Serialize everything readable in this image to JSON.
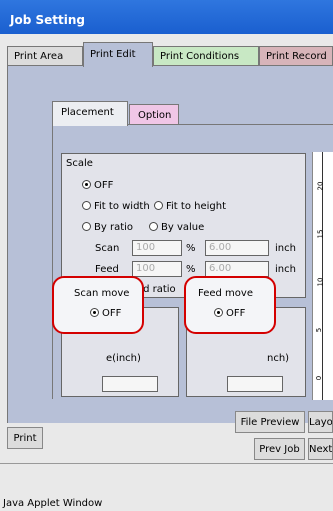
{
  "window": {
    "title": "Job Setting",
    "footer": "Java Applet Window"
  },
  "tabs": [
    "Print Area",
    "Print Edit",
    "Print Conditions",
    "Print Record"
  ],
  "inner_tabs": [
    "Placement",
    "Option"
  ],
  "scale": {
    "title": "Scale",
    "opt_off": "OFF",
    "opt_fit_width": "Fit to width",
    "opt_fit_height": "Fit to height",
    "opt_by_ratio": "By ratio",
    "opt_by_value": "By value",
    "scan_label": "Scan",
    "feed_label": "Feed",
    "scan_ratio": "100",
    "feed_ratio": "100",
    "percent": "%",
    "scan_value": "6.00",
    "feed_value": "6.00",
    "unit": "inch",
    "fixed_ratio": "Enter fixed ratio"
  },
  "scan_move": {
    "title": "Scan move",
    "value": "OFF",
    "hidden_label": "e(inch)"
  },
  "feed_move": {
    "title": "Feed move",
    "value": "OFF",
    "hidden_label": "nch)"
  },
  "buttons": {
    "print": "Print",
    "file_preview": "File Preview",
    "layout": "Layo",
    "prev_job": "Prev Job",
    "next": "Next"
  },
  "ruler": {
    "ticks": [
      "20",
      "15",
      "10",
      "5",
      "0"
    ]
  },
  "colors": {
    "title_bar": "#1a5fcf",
    "panel": "#b7c0d7",
    "highlight": "#d40000",
    "tab_print_conditions": "#c8e8c4",
    "tab_print_record": "#d7b4b9",
    "tab_option": "#f0c6e6"
  }
}
